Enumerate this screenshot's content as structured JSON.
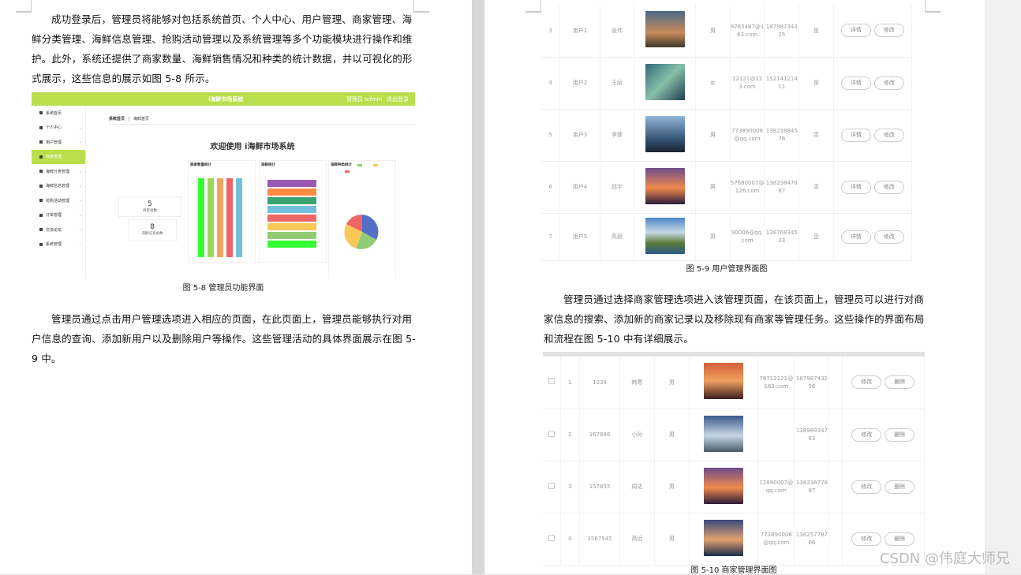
{
  "left_page": {
    "para1": "成功登录后，管理员将能够对包括系统首页、个人中心、用户管理、商家管理、海鲜分类管理、海鲜信息管理、抢购活动管理以及系统管理等多个功能模块进行操作和维护。此外，系统还提供了商家数量、海鲜销售情况和种类的统计数据，并以可视化的形式展示，这些信息的展示如图 5-8 所示。",
    "caption1": "图 5-8 管理员功能界面",
    "para2": "管理员通过点击用户管理选项进入相应的页面，在此页面上，管理员能够执行对用户信息的查询、添加新用户以及删除用户等操作。这些管理活动的具体界面展示在图 5-9 中。"
  },
  "admin_shot": {
    "app_title": "i海鲜市场系统",
    "admin_label": "管理员 admin",
    "logout": "退出登录",
    "breadcrumb_home": "系统首页",
    "breadcrumb_sep": "|",
    "breadcrumb_current": "海鲜首页",
    "welcome": "欢迎使用 i海鲜市场系统",
    "side_items": [
      "系统首页",
      "个人中心",
      "用户管理",
      "商家管理",
      "海鲜分类管理",
      "海鲜信息管理",
      "抢购活动管理",
      "订单管理",
      "交流论坛",
      "系统管理"
    ],
    "stat1_value": "5",
    "stat1_label": "商家总数",
    "stat2_value": "8",
    "stat2_label": "海鲜信息总数",
    "panel1_title": "商家数量统计",
    "panel2_title": "海鲜统计",
    "panel3_title": "海鲜种类统计",
    "colors": {
      "topbar": "#b9df4d",
      "bar_green": "#33ff33",
      "bar_lime": "#9fd55a",
      "bar_orange": "#f4a261",
      "bar_red": "#ee6666",
      "bar_blue": "#73c0de",
      "pie_blue": "#5470c6",
      "pie_green": "#91cc75",
      "pie_yellow": "#fac858",
      "pie_red": "#ee6666"
    }
  },
  "right_page": {
    "user_rows": [
      {
        "idx": "3",
        "account": "用户1",
        "name": "张伟",
        "gender": "男",
        "email": "9765467@163.com",
        "phone": "18798734325",
        "vip": "是"
      },
      {
        "idx": "4",
        "account": "用户2",
        "name": "王丽",
        "gender": "女",
        "email": "12121@123.com",
        "phone": "15214121411",
        "vip": "是"
      },
      {
        "idx": "5",
        "account": "用户3",
        "name": "李健",
        "gender": "男",
        "email": "773890008@qq.com",
        "phone": "13823884576",
        "vip": "否"
      },
      {
        "idx": "6",
        "account": "用户4",
        "name": "邱宇",
        "gender": "男",
        "email": "57680007@126.com",
        "phone": "13823847887",
        "vip": "否"
      },
      {
        "idx": "7",
        "account": "用户5",
        "name": "高斌",
        "gender": "男",
        "email": "90006@qq.com",
        "phone": "13876834533",
        "vip": "否"
      }
    ],
    "btn_detail": "详情",
    "btn_edit": "修改",
    "btn_delete": "删除",
    "caption2": "图 5-9 用户管理界面图",
    "para3": "管理员通过选择商家管理选项进入该管理页面，在该页面上，管理员可以进行对商家信息的搜索、添加新的商家记录以及移除现有商家等管理任务。这些操作的界面布局和流程在图 5-10 中有详细展示。",
    "merchant_rows": [
      {
        "idx": "1",
        "account": "1234",
        "name": "韩寒",
        "gender": "男",
        "email": "76712121@163.com",
        "phone": "18798743256"
      },
      {
        "idx": "2",
        "account": "167886",
        "name": "小孙",
        "gender": "男",
        "email": "",
        "phone": "13898934783"
      },
      {
        "idx": "3",
        "account": "157855",
        "name": "周达",
        "gender": "男",
        "email": "12890007@qq.com",
        "phone": "13823677887"
      },
      {
        "idx": "4",
        "account": "3567545",
        "name": "高远",
        "gender": "男",
        "email": "773890006@qq.com",
        "phone": "13825778766"
      }
    ],
    "caption3": "图 5-10 商家管理界面图"
  },
  "watermark": "CSDN @伟庭大师兄"
}
